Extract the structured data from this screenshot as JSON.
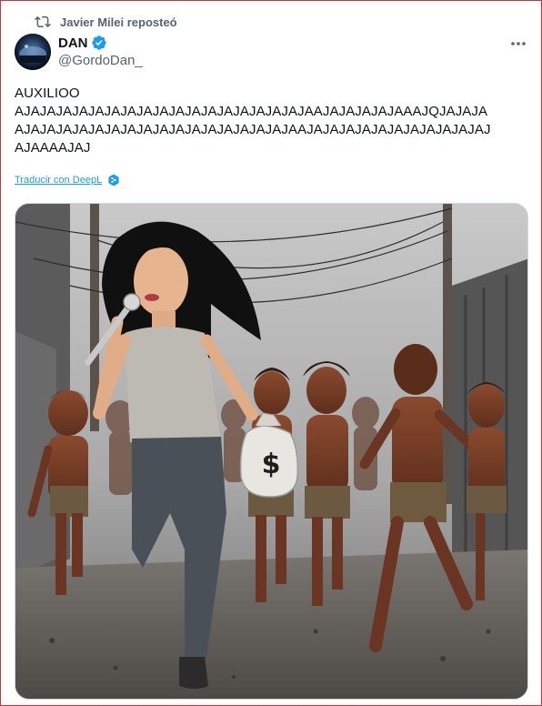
{
  "repost": {
    "text": "Javier Milei reposteó",
    "icon": "repost-icon"
  },
  "author": {
    "display_name": "DAN",
    "handle": "@GordoDan_",
    "verified": true,
    "verified_color": "#1d9bf0"
  },
  "tweet": {
    "lines": [
      "AUXILIOO",
      "AJAJAJAJAJAJAJAJAJAJAJAJAJAJAJAJAJAJAAJAJAJAJAJAAAJQJAJAJA",
      "AJAJAJAJAJAJAJAJAJAJAJAJAJAJAJAJAJAAJAJAJAJAJAJAJAJAJAJAJAJ",
      "AJAAAAJAJ"
    ]
  },
  "translate": {
    "label": "Traducir con DeepL",
    "icon": "deepl-icon"
  },
  "menu": {
    "icon": "more-icon"
  },
  "colors": {
    "text": "#0f1419",
    "secondary": "#536471",
    "link": "#1d9bf0"
  }
}
